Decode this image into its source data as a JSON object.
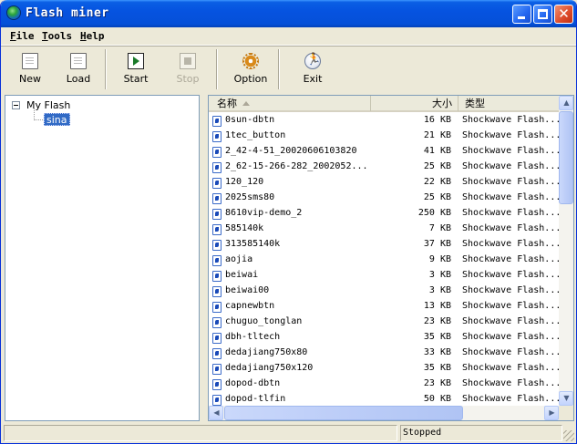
{
  "window": {
    "title": "Flash miner",
    "icon": "globe-icon"
  },
  "menu": [
    "File",
    "Tools",
    "Help"
  ],
  "toolbar": {
    "new_label": "New",
    "load_label": "Load",
    "start_label": "Start",
    "stop_label": "Stop",
    "option_label": "Option",
    "exit_label": "Exit"
  },
  "tree": {
    "root": "My Flash",
    "child": "sina"
  },
  "list": {
    "columns": {
      "name": "名称",
      "size": "大小",
      "type": "类型"
    },
    "rows": [
      {
        "name": "0sun-dbtn",
        "size": "16 KB",
        "type": "Shockwave Flash..."
      },
      {
        "name": "1tec_button",
        "size": "21 KB",
        "type": "Shockwave Flash..."
      },
      {
        "name": "2_42-4-51_20020606103820",
        "size": "41 KB",
        "type": "Shockwave Flash..."
      },
      {
        "name": "2_62-15-266-282_2002052...",
        "size": "25 KB",
        "type": "Shockwave Flash..."
      },
      {
        "name": "120_120",
        "size": "22 KB",
        "type": "Shockwave Flash..."
      },
      {
        "name": "2025sms80",
        "size": "25 KB",
        "type": "Shockwave Flash..."
      },
      {
        "name": "8610vip-demo_2",
        "size": "250 KB",
        "type": "Shockwave Flash..."
      },
      {
        "name": "585140k",
        "size": "7 KB",
        "type": "Shockwave Flash..."
      },
      {
        "name": "313585140k",
        "size": "37 KB",
        "type": "Shockwave Flash..."
      },
      {
        "name": "aojia",
        "size": "9 KB",
        "type": "Shockwave Flash..."
      },
      {
        "name": "beiwai",
        "size": "3 KB",
        "type": "Shockwave Flash..."
      },
      {
        "name": "beiwai00",
        "size": "3 KB",
        "type": "Shockwave Flash..."
      },
      {
        "name": "capnewbtn",
        "size": "13 KB",
        "type": "Shockwave Flash..."
      },
      {
        "name": "chuguo_tonglan",
        "size": "23 KB",
        "type": "Shockwave Flash..."
      },
      {
        "name": "dbh-tltech",
        "size": "35 KB",
        "type": "Shockwave Flash..."
      },
      {
        "name": "dedajiang750x80",
        "size": "33 KB",
        "type": "Shockwave Flash..."
      },
      {
        "name": "dedajiang750x120",
        "size": "35 KB",
        "type": "Shockwave Flash..."
      },
      {
        "name": "dopod-dbtn",
        "size": "23 KB",
        "type": "Shockwave Flash..."
      },
      {
        "name": "dopod-tlfin",
        "size": "50 KB",
        "type": "Shockwave Flash..."
      }
    ]
  },
  "status": {
    "panel1": "",
    "panel2": "Stopped"
  }
}
